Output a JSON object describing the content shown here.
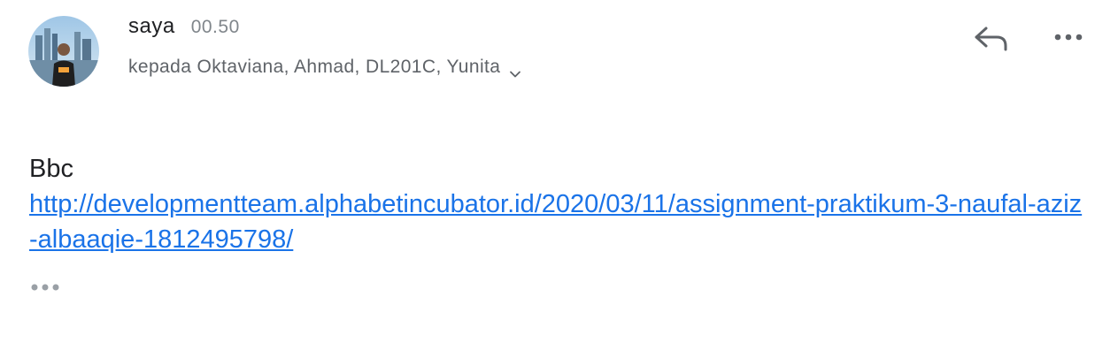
{
  "sender": {
    "name": "saya",
    "time": "00.50"
  },
  "recipients": {
    "label": "kepada Oktaviana, Ahmad, DL201C, Yunita"
  },
  "icons": {
    "reply": "reply-arrow-icon",
    "more": "more-horizontal-icon",
    "expand": "chevron-down-icon",
    "trimmed": "ellipsis-icon"
  },
  "message": {
    "text": "Bbc",
    "link": "http://developmentteam.alphabetincubator.id/2020/03/11/assignment-praktikum-3-naufal-aziz-albaaqie-1812495798/"
  },
  "colors": {
    "link": "#1a73e8",
    "primary_text": "#202124",
    "secondary_text": "#5f6368"
  }
}
